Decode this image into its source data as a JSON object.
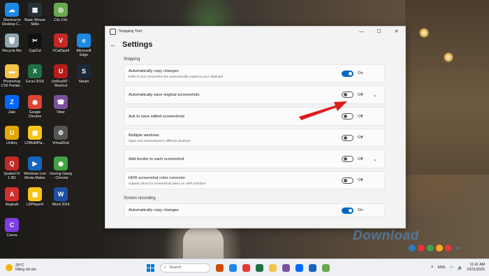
{
  "desktop": {
    "icons": [
      {
        "label": "Shortcut to Desktop C...",
        "color": "#1e88e5",
        "glyph": "☁"
      },
      {
        "label": "Basic Mouse Skills",
        "color": "#263238",
        "glyph": "▦"
      },
      {
        "label": "Cốc Cốc",
        "color": "#6aa84f",
        "glyph": "◎"
      },
      {
        "label": "Recycle Bin",
        "color": "#90a4ae",
        "glyph": "🗑"
      },
      {
        "label": "CapCut",
        "color": "#111111",
        "glyph": "✂"
      },
      {
        "label": "VCallSpell",
        "color": "#c62828",
        "glyph": "V"
      },
      {
        "label": "Microsoft Edge",
        "color": "#1e88e5",
        "glyph": "e"
      },
      {
        "label": "Photoshop CS6 Portab...",
        "color": "#f3c34a",
        "glyph": "▬"
      },
      {
        "label": "Excel 2016",
        "color": "#1d7044",
        "glyph": "X"
      },
      {
        "label": "UniKeyNT - Shortcut",
        "color": "#b71c1c",
        "glyph": "U"
      },
      {
        "label": "Steam",
        "color": "#1b2838",
        "glyph": "S"
      },
      {
        "label": "Zalo",
        "color": "#0068ff",
        "glyph": "Z"
      },
      {
        "label": "Google Chrome",
        "color": "#db4437",
        "glyph": "◉"
      },
      {
        "label": "Viber",
        "color": "#7b519d",
        "glyph": "☎"
      },
      {
        "label": "Unikey",
        "color": "#e0a800",
        "glyph": "U"
      },
      {
        "label": "LDMultiPla...",
        "color": "#f5c518",
        "glyph": "▣"
      },
      {
        "label": "VirtualDub",
        "color": "#555555",
        "glyph": "⚙"
      },
      {
        "label": "Quabel-IV 1.9f1",
        "color": "#c62828",
        "glyph": "Q"
      },
      {
        "label": "Windows Live Movie Maker",
        "color": "#1565c0",
        "glyph": "▶"
      },
      {
        "label": "Hương Giang - Chrome",
        "color": "#43a047",
        "glyph": "◉"
      },
      {
        "label": "Aegisub",
        "color": "#d32f2f",
        "glyph": "A"
      },
      {
        "label": "LDPlayer9",
        "color": "#f5c518",
        "glyph": "▣"
      },
      {
        "label": "Word 2016",
        "color": "#1e4fa3",
        "glyph": "W"
      },
      {
        "label": "Canva",
        "color": "#7b3fe4",
        "glyph": "C"
      }
    ]
  },
  "window": {
    "title": "Snipping Tool",
    "minimize_icon": "—",
    "maximize_icon": "☐",
    "close_icon": "✕",
    "back_icon": "←",
    "page_title": "Settings",
    "section_snipping": "Snipping",
    "section_recording": "Screen recording",
    "rows": [
      {
        "name": "Automatically copy changes",
        "desc": "Edits to your screenshot are automatically copied to your clipboard",
        "state": "On",
        "on": true,
        "chevron": ""
      },
      {
        "name": "Automatically save original screenshots",
        "desc": "",
        "state": "Off",
        "on": false,
        "chevron": "⌄"
      },
      {
        "name": "Ask to save edited screenshots",
        "desc": "",
        "state": "Off",
        "on": false,
        "chevron": ""
      },
      {
        "name": "Multiple windows",
        "desc": "Open new screenshots in different windows",
        "state": "Off",
        "on": false,
        "chevron": ""
      },
      {
        "name": "Add border to each screenshot",
        "desc": "",
        "state": "Off",
        "on": false,
        "chevron": "⌄"
      },
      {
        "name": "HDR screenshot color corrector",
        "desc": "Adjusts colors for screenshots taken on HDR monitors",
        "state": "Off",
        "on": false,
        "chevron": ""
      }
    ],
    "recording_row": {
      "name": "Automatically copy changes",
      "state": "On",
      "on": true
    }
  },
  "watermark": {
    "text": "Download",
    "suffix": ".vn",
    "dot_colors": [
      "#2a78c7",
      "#e53935",
      "#43a047",
      "#f9a825",
      "#e53935"
    ]
  },
  "taskbar": {
    "temp": "29°C",
    "weather": "Nắng rải rác",
    "search_placeholder": "Search",
    "lang": "ENG",
    "time": "11:41 AM",
    "date": "10/11/2025",
    "apps": [
      "#d04a02",
      "#1e88e5",
      "#e53935",
      "#1d7044",
      "#f3c34a",
      "#7b519d",
      "#0068ff",
      "#1565c0",
      "#6aa84f"
    ]
  },
  "accent": "#0067c0",
  "arrow_color": "#e01b1b"
}
